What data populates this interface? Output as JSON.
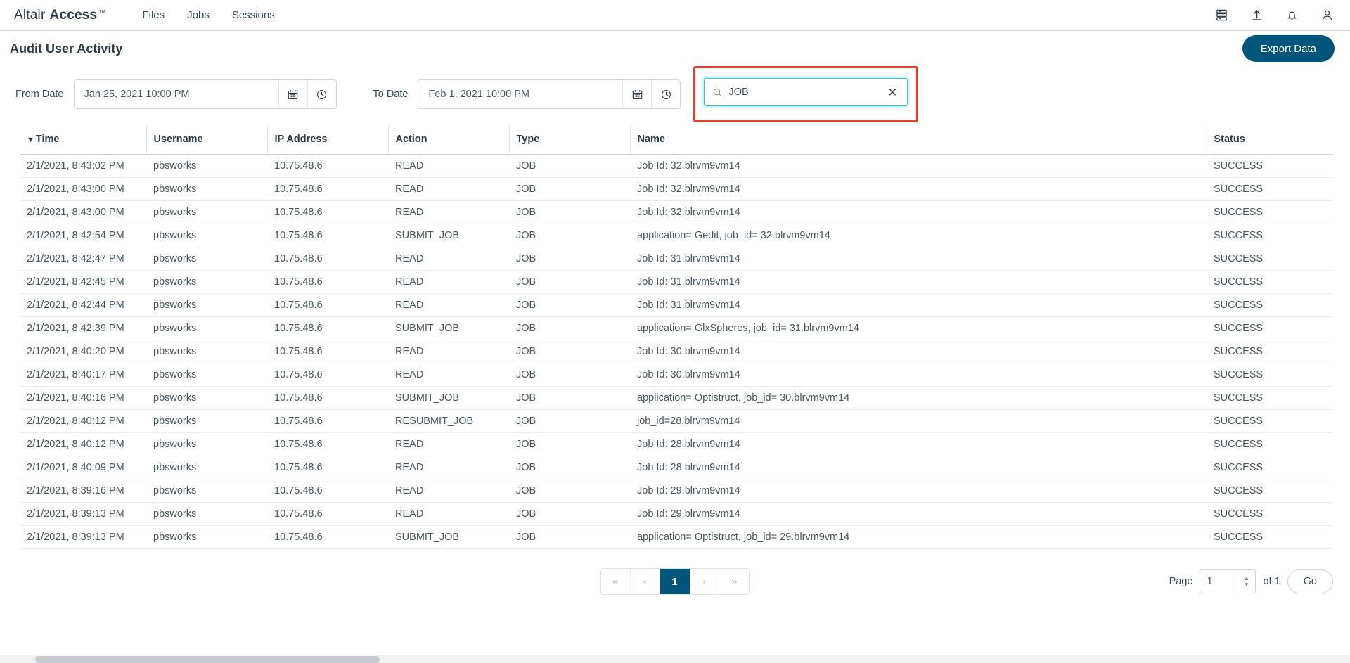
{
  "topbar": {
    "brand_light": "Altair",
    "brand_bold": "Access",
    "brand_tm": "™",
    "nav": [
      {
        "label": "Files"
      },
      {
        "label": "Jobs"
      },
      {
        "label": "Sessions"
      }
    ],
    "icons": [
      {
        "name": "server-rack-icon"
      },
      {
        "name": "upload-icon"
      },
      {
        "name": "notification-bell-icon"
      },
      {
        "name": "user-account-icon"
      }
    ]
  },
  "header": {
    "title": "Audit User Activity",
    "export_label": "Export Data"
  },
  "filters": {
    "from_label": "From Date",
    "from_value": "Jan 25, 2021 10:00 PM",
    "to_label": "To Date",
    "to_value": "Feb 1, 2021 10:00 PM",
    "calendar_icon": "calendar-icon",
    "clock_icon": "clock-icon",
    "search_value": "JOB",
    "search_placeholder": "Search",
    "search_clear_label": "✕",
    "annotation_color": "#e8402a",
    "focus_color": "#31c6e0"
  },
  "table": {
    "columns": [
      {
        "key": "time",
        "label": "Time",
        "sorted": "desc",
        "caret": "▼"
      },
      {
        "key": "username",
        "label": "Username"
      },
      {
        "key": "ip",
        "label": "IP Address"
      },
      {
        "key": "action",
        "label": "Action"
      },
      {
        "key": "type",
        "label": "Type"
      },
      {
        "key": "name",
        "label": "Name"
      },
      {
        "key": "status",
        "label": "Status"
      }
    ],
    "rows": [
      {
        "time": "2/1/2021, 8:43:02 PM",
        "username": "pbsworks",
        "ip": "10.75.48.6",
        "action": "READ",
        "type": "JOB",
        "name": "Job Id: 32.blrvm9vm14",
        "status": "SUCCESS"
      },
      {
        "time": "2/1/2021, 8:43:00 PM",
        "username": "pbsworks",
        "ip": "10.75.48.6",
        "action": "READ",
        "type": "JOB",
        "name": "Job Id: 32.blrvm9vm14",
        "status": "SUCCESS"
      },
      {
        "time": "2/1/2021, 8:43:00 PM",
        "username": "pbsworks",
        "ip": "10.75.48.6",
        "action": "READ",
        "type": "JOB",
        "name": "Job Id: 32.blrvm9vm14",
        "status": "SUCCESS"
      },
      {
        "time": "2/1/2021, 8:42:54 PM",
        "username": "pbsworks",
        "ip": "10.75.48.6",
        "action": "SUBMIT_JOB",
        "type": "JOB",
        "name": "application= Gedit, job_id= 32.blrvm9vm14",
        "status": "SUCCESS"
      },
      {
        "time": "2/1/2021, 8:42:47 PM",
        "username": "pbsworks",
        "ip": "10.75.48.6",
        "action": "READ",
        "type": "JOB",
        "name": "Job Id: 31.blrvm9vm14",
        "status": "SUCCESS"
      },
      {
        "time": "2/1/2021, 8:42:45 PM",
        "username": "pbsworks",
        "ip": "10.75.48.6",
        "action": "READ",
        "type": "JOB",
        "name": "Job Id: 31.blrvm9vm14",
        "status": "SUCCESS"
      },
      {
        "time": "2/1/2021, 8:42:44 PM",
        "username": "pbsworks",
        "ip": "10.75.48.6",
        "action": "READ",
        "type": "JOB",
        "name": "Job Id: 31.blrvm9vm14",
        "status": "SUCCESS"
      },
      {
        "time": "2/1/2021, 8:42:39 PM",
        "username": "pbsworks",
        "ip": "10.75.48.6",
        "action": "SUBMIT_JOB",
        "type": "JOB",
        "name": "application= GlxSpheres, job_id= 31.blrvm9vm14",
        "status": "SUCCESS"
      },
      {
        "time": "2/1/2021, 8:40:20 PM",
        "username": "pbsworks",
        "ip": "10.75.48.6",
        "action": "READ",
        "type": "JOB",
        "name": "Job Id: 30.blrvm9vm14",
        "status": "SUCCESS"
      },
      {
        "time": "2/1/2021, 8:40:17 PM",
        "username": "pbsworks",
        "ip": "10.75.48.6",
        "action": "READ",
        "type": "JOB",
        "name": "Job Id: 30.blrvm9vm14",
        "status": "SUCCESS"
      },
      {
        "time": "2/1/2021, 8:40:16 PM",
        "username": "pbsworks",
        "ip": "10.75.48.6",
        "action": "SUBMIT_JOB",
        "type": "JOB",
        "name": "application= Optistruct, job_id= 30.blrvm9vm14",
        "status": "SUCCESS"
      },
      {
        "time": "2/1/2021, 8:40:12 PM",
        "username": "pbsworks",
        "ip": "10.75.48.6",
        "action": "RESUBMIT_JOB",
        "type": "JOB",
        "name": "job_id=28.blrvm9vm14",
        "status": "SUCCESS"
      },
      {
        "time": "2/1/2021, 8:40:12 PM",
        "username": "pbsworks",
        "ip": "10.75.48.6",
        "action": "READ",
        "type": "JOB",
        "name": "Job Id: 28.blrvm9vm14",
        "status": "SUCCESS"
      },
      {
        "time": "2/1/2021, 8:40:09 PM",
        "username": "pbsworks",
        "ip": "10.75.48.6",
        "action": "READ",
        "type": "JOB",
        "name": "Job Id: 28.blrvm9vm14",
        "status": "SUCCESS"
      },
      {
        "time": "2/1/2021, 8:39:16 PM",
        "username": "pbsworks",
        "ip": "10.75.48.6",
        "action": "READ",
        "type": "JOB",
        "name": "Job Id: 29.blrvm9vm14",
        "status": "SUCCESS"
      },
      {
        "time": "2/1/2021, 8:39:13 PM",
        "username": "pbsworks",
        "ip": "10.75.48.6",
        "action": "READ",
        "type": "JOB",
        "name": "Job Id: 29.blrvm9vm14",
        "status": "SUCCESS"
      },
      {
        "time": "2/1/2021, 8:39:13 PM",
        "username": "pbsworks",
        "ip": "10.75.48.6",
        "action": "SUBMIT_JOB",
        "type": "JOB",
        "name": "application= Optistruct, job_id= 29.blrvm9vm14",
        "status": "SUCCESS"
      }
    ]
  },
  "pagination": {
    "first_label": "«",
    "prev_label": "‹",
    "current_page": "1",
    "next_label": "›",
    "last_label": "»",
    "page_label": "Page",
    "page_value": "1",
    "of_label": "of 1",
    "go_label": "Go",
    "active_color": "#00567a"
  }
}
